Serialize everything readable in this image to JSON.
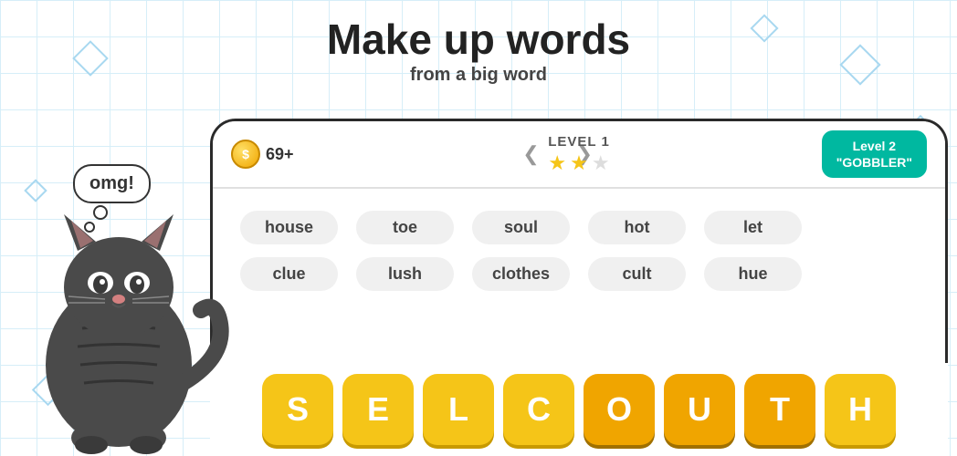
{
  "header": {
    "title": "Make up words",
    "subtitle": "from a big word"
  },
  "topbar": {
    "coins": "69+",
    "level_label": "LEVEL 1",
    "stars": [
      true,
      true,
      false
    ],
    "nav_left": "❮",
    "nav_right": "❯",
    "next_level_label": "Level 2",
    "next_level_word": "\"GOBBLER\""
  },
  "words": {
    "row1": [
      "house",
      "toe",
      "soul",
      "hot",
      "let"
    ],
    "row2": [
      "clue",
      "lush",
      "clothes",
      "cult",
      "hue"
    ]
  },
  "tiles": [
    "S",
    "E",
    "L",
    "C",
    "O",
    "U",
    "T",
    "H"
  ],
  "highlighted_tiles": [
    4,
    5,
    6
  ],
  "speech_bubble": "omg!",
  "decorations": {
    "diamonds": 6
  }
}
